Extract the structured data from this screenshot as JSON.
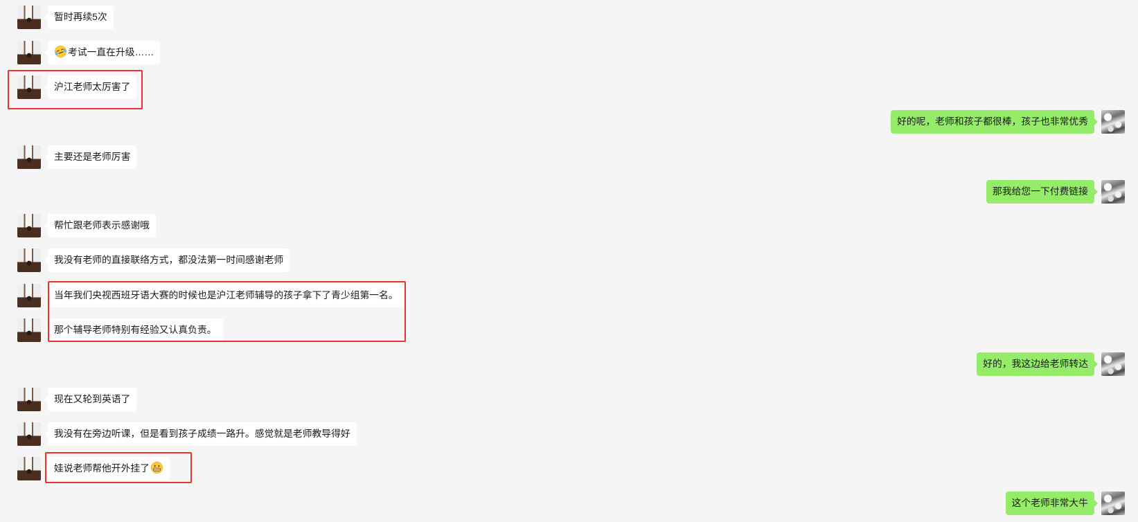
{
  "chat": {
    "messages": [
      {
        "sender": "contact",
        "text": "暂时再续5次"
      },
      {
        "sender": "contact",
        "emoji": "laughing-with-tears-icon",
        "text": "考试一直在升级……"
      },
      {
        "sender": "contact",
        "text": "沪江老师太厉害了"
      },
      {
        "sender": "self",
        "text": "好的呢，老师和孩子都很棒，孩子也非常优秀"
      },
      {
        "sender": "contact",
        "text": "主要还是老师厉害"
      },
      {
        "sender": "self",
        "text": "那我给您一下付费链接"
      },
      {
        "sender": "contact",
        "text": "帮忙跟老师表示感谢哦"
      },
      {
        "sender": "contact",
        "text": "我没有老师的直接联络方式，都没法第一时间感谢老师"
      },
      {
        "sender": "contact",
        "text": "当年我们央视西班牙语大赛的时候也是沪江老师辅导的孩子拿下了青少组第一名。"
      },
      {
        "sender": "contact",
        "text": "那个辅导老师特别有经验又认真负责。"
      },
      {
        "sender": "self",
        "text": "好的，我这边给老师转达"
      },
      {
        "sender": "contact",
        "text": "现在又轮到英语了"
      },
      {
        "sender": "contact",
        "text": "我没有在旁边听课，但是看到孩子成绩一路升。感觉就是老师教导得好"
      },
      {
        "sender": "contact",
        "text": "娃说老师帮他开外挂了",
        "emoji": "grinning-icon"
      },
      {
        "sender": "self",
        "text": "这个老师非常大牛"
      }
    ]
  },
  "colors": {
    "background": "#f5f5f5",
    "incoming_bubble": "#ffffff",
    "outgoing_bubble": "#95ec69",
    "highlight": "#e8322b",
    "text": "#191919"
  }
}
